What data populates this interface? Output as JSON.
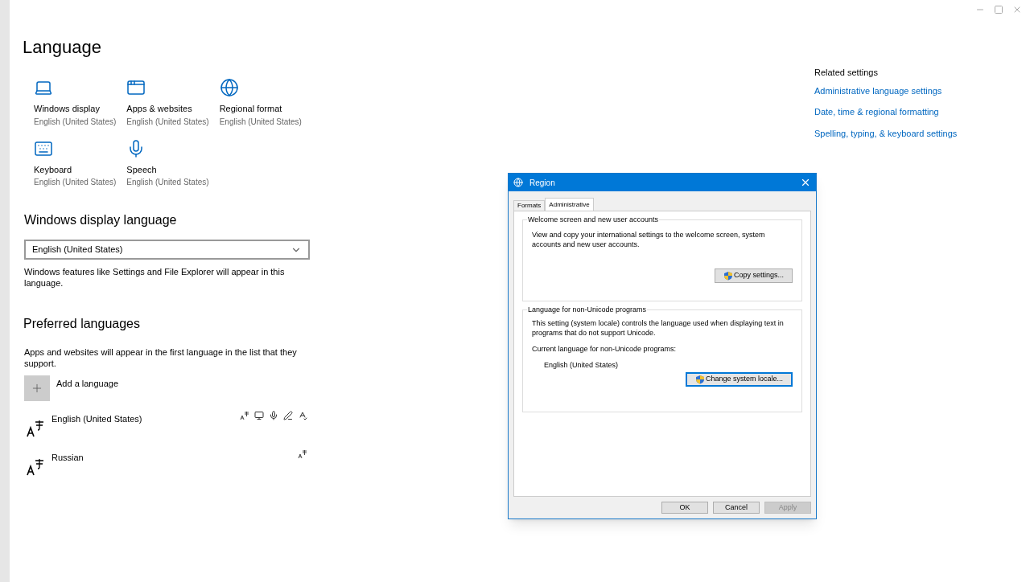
{
  "page": {
    "title": "Language"
  },
  "tiles": [
    {
      "kind": "display",
      "label": "Windows display",
      "value": "English (United States)"
    },
    {
      "kind": "apps",
      "label": "Apps & websites",
      "value": "English (United States)"
    },
    {
      "kind": "region",
      "label": "Regional format",
      "value": "English (United States)"
    },
    {
      "kind": "keyboard",
      "label": "Keyboard",
      "value": "English (United States)"
    },
    {
      "kind": "speech",
      "label": "Speech",
      "value": "English (United States)"
    }
  ],
  "display_language": {
    "heading": "Windows display language",
    "value": "English (United States)",
    "note": "Windows features like Settings and File Explorer will appear in this language."
  },
  "preferred": {
    "heading": "Preferred languages",
    "note": "Apps and websites will appear in the first language in the list that they support.",
    "add_label": "Add a language",
    "languages": [
      {
        "name": "English (United States)",
        "features": [
          {
            "kind": "pack"
          },
          {
            "kind": "display"
          },
          {
            "kind": "speech"
          },
          {
            "kind": "handwriting"
          },
          {
            "kind": "spelling"
          }
        ]
      },
      {
        "name": "Russian",
        "features": [
          {
            "kind": "pack"
          }
        ]
      }
    ]
  },
  "related": {
    "heading": "Related settings",
    "links": [
      "Administrative language settings",
      "Date, time & regional formatting",
      "Spelling, typing, & keyboard settings"
    ]
  },
  "dialog": {
    "title": "Region",
    "tabs": [
      {
        "label": "Formats",
        "selected": false
      },
      {
        "label": "Administrative",
        "selected": true
      }
    ],
    "groups": [
      {
        "title": "Welcome screen and new user accounts",
        "text": "View and copy your international settings to the welcome screen, system accounts and new user accounts.",
        "button": {
          "label": "Copy settings...",
          "focused": false
        }
      },
      {
        "title": "Language for non-Unicode programs",
        "text": "This setting (system locale) controls the language used when displaying text in programs that do not support Unicode.",
        "current_label": "Current language for non-Unicode programs:",
        "current_value": "English (United States)",
        "button": {
          "label": "Change system locale...",
          "focused": true
        }
      }
    ],
    "buttons": [
      {
        "label": "OK",
        "disabled": false
      },
      {
        "label": "Cancel",
        "disabled": false
      },
      {
        "label": "Apply",
        "disabled": true
      }
    ]
  }
}
